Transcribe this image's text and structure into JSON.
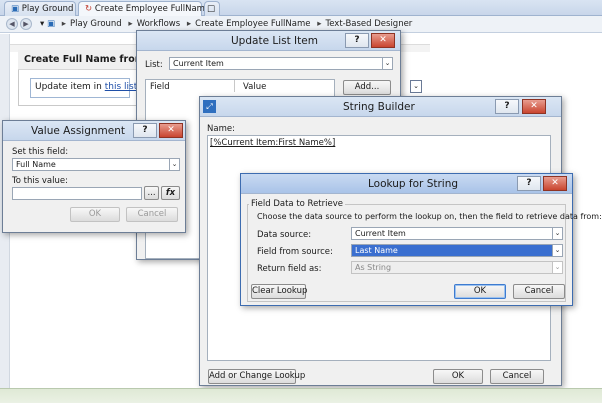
{
  "browser": {
    "tabs": [
      "Play Ground",
      "Create Employee FullName *"
    ],
    "breadcrumbs": [
      "Play Ground",
      "Workflows",
      "Create Employee FullName",
      "Text-Based Designer"
    ],
    "separator": "▸"
  },
  "designer": {
    "card_title": "Create Full Name from Fir",
    "step_text": "Update item in",
    "step_link": "this list"
  },
  "update_list_item": {
    "title": "Update List Item",
    "help": "?",
    "close": "✕",
    "list_label": "List:",
    "list_value": "Current Item",
    "columns": [
      "Field",
      "Value"
    ],
    "add_button": "Add..."
  },
  "value_assignment": {
    "title": "Value Assignment",
    "help": "?",
    "close": "✕",
    "set_field_label": "Set this field:",
    "set_field_value": "Full Name",
    "to_value_label": "To this value:",
    "to_value_value": "",
    "ellipsis_button": "...",
    "fx_button": "fx",
    "ok": "OK",
    "cancel": "Cancel"
  },
  "string_builder": {
    "title": "String Builder",
    "help": "?",
    "close": "✕",
    "name_label": "Name:",
    "content": "[%Current Item:First Name%]",
    "add_change_lookup": "Add or Change Lookup",
    "ok": "OK",
    "cancel": "Cancel"
  },
  "lookup_for_string": {
    "title": "Lookup for String",
    "help": "?",
    "close": "✕",
    "group_label": "Field Data to Retrieve",
    "instructions": "Choose the data source to perform the lookup on, then the field to retrieve data from:",
    "data_source_label": "Data source:",
    "data_source_value": "Current Item",
    "field_from_source_label": "Field from source:",
    "field_from_source_value": "Last Name",
    "return_field_label": "Return field as:",
    "return_field_value": "As String",
    "clear_lookup": "Clear Lookup",
    "ok": "OK",
    "cancel": "Cancel"
  },
  "icons": {
    "dropdown_arrow": "⌄",
    "back": "◀",
    "forward": "▶"
  }
}
